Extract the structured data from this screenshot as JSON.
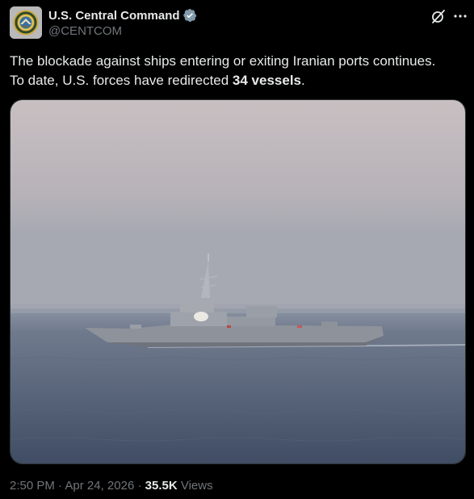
{
  "author": {
    "display_name": "U.S. Central Command",
    "handle": "@CENTCOM",
    "verified_icon": "verified-badge-icon",
    "avatar_icon": "centcom-seal-avatar"
  },
  "header_actions": {
    "grok_icon": "grok-icon",
    "more_icon": "more-options-icon"
  },
  "post": {
    "line1": "The blockade against ships entering or exiting Iranian ports continues.",
    "line2_prefix": "To date, U.S. forces have redirected ",
    "line2_bold": "34 vessels",
    "line2_suffix": "."
  },
  "media": {
    "description_icon": "warship-photo"
  },
  "meta": {
    "time": "2:50 PM",
    "sep1": " · ",
    "date": "Apr 24, 2026",
    "sep2": " · ",
    "views_count": "35.5K",
    "views_label": " Views"
  },
  "colors": {
    "background": "#000000",
    "text_primary": "#e7e9ea",
    "text_secondary": "#71767b",
    "verified_badge": "#829aab",
    "border": "#2f3336"
  }
}
